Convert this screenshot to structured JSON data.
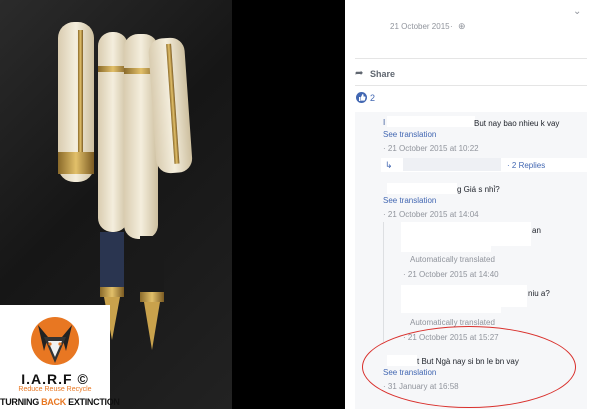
{
  "post": {
    "timestamp": "21 October 2015",
    "share_label": "Share",
    "like_count": "2"
  },
  "logo": {
    "name": "I.A.R.F ©",
    "tagline": "Reduce Reuse Recycle",
    "slogan_prefix": "TURNING ",
    "slogan_highlight": "BACK",
    "slogan_suffix": " EXTINCTION"
  },
  "comments": [
    {
      "text": "But nay bao nhieu k vay",
      "see_translation": "See translation",
      "time": "21 October 2015 at 10:22",
      "replies": "2 Replies"
    },
    {
      "text": "g Giá s nhỉ?",
      "see_translation": "See translation",
      "time": "21 October 2015 at 14:04",
      "replies_list": [
        {
          "text": "an",
          "auto": "Automatically translated",
          "time": "21 October 2015 at 14:40"
        },
        {
          "text": "niu a?",
          "auto": "Automatically translated",
          "time": "21 October 2015 at 15:27"
        }
      ]
    },
    {
      "text": "t But Ngà nay si bn le bn vay",
      "see_translation": "See translation",
      "time": "31 January at 16:58"
    }
  ],
  "colors": {
    "link": "#4267b2",
    "meta": "#90949c",
    "annotation": "#d9302c",
    "brand_orange": "#e87722"
  }
}
